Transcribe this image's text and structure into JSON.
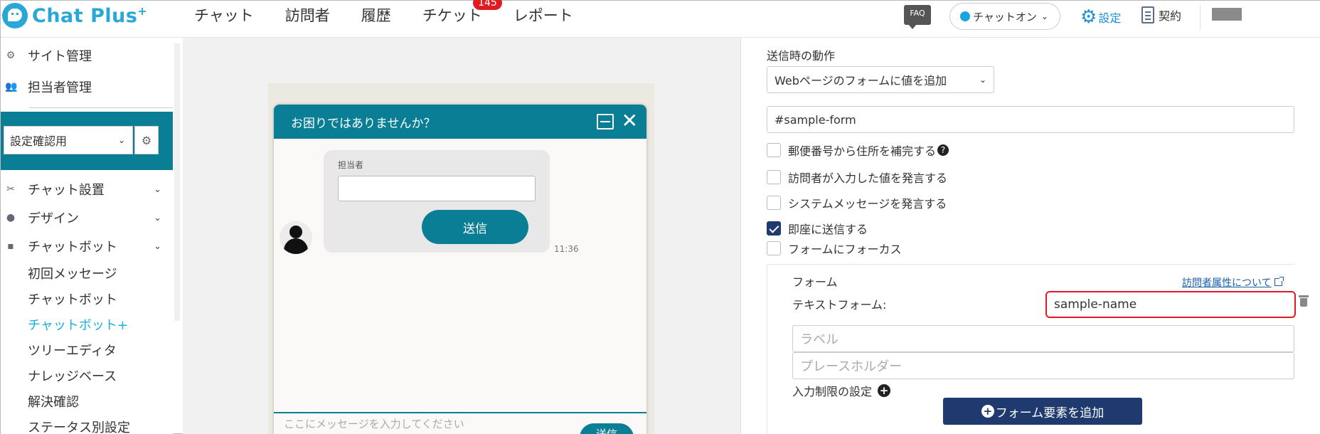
{
  "app": {
    "logo": "Chat Plus",
    "logo_sup": "+"
  },
  "nav": {
    "items": [
      "チャット",
      "訪問者",
      "履歴",
      "チケット",
      "レポート"
    ],
    "ticket_badge": "145"
  },
  "header": {
    "faq": "FAQ",
    "status": "チャットオン",
    "settings": "設定",
    "contract": "契約"
  },
  "sidebar": {
    "site_admin": "サイト管理",
    "staff_admin": "担当者管理",
    "site_select": "設定確認用",
    "chat_settings": "チャット設置",
    "design": "デザイン",
    "chatbot": "チャットボット",
    "sub_items": [
      "初回メッセージ",
      "チャットボット",
      "チャットボット+",
      "ツリーエディタ",
      "ナレッジベース",
      "解決確認",
      "ステータス別設定"
    ]
  },
  "chat": {
    "title": "お困りではありませんか？",
    "field_label": "担当者",
    "submit": "送信",
    "time": "11:36",
    "input_placeholder": "ここにメッセージを入力してください",
    "send": "送信"
  },
  "panel": {
    "on_submit_label": "送信時の動作",
    "action_select": "Webページのフォームに値を追加",
    "form_selector": "#sample-form",
    "checkboxes": [
      {
        "label": "郵便番号から住所を補完する",
        "checked": false
      },
      {
        "label": "訪問者が入力した値を発言する",
        "checked": false
      },
      {
        "label": "システムメッセージを発言する",
        "checked": false
      },
      {
        "label": "即座に送信する",
        "checked": true
      },
      {
        "label": "フォームにフォーカス",
        "checked": false
      }
    ],
    "form_label": "フォーム",
    "visitor_attr_link": "訪問者属性について",
    "text_form_label": "テキストフォーム:",
    "text_form_value": "sample-name",
    "label_placeholder": "ラベル",
    "placeholder_placeholder": "プレースホルダー",
    "input_limit": "入力制限の設定",
    "add_form_element": "フォーム要素を追加"
  }
}
